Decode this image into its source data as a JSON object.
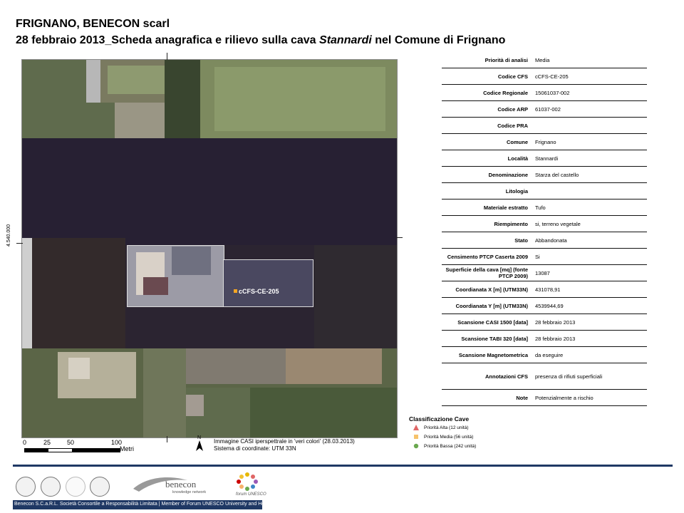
{
  "header": {
    "line1": "FRIGNANO, BENECON scarl",
    "line2_prefix": "28 febbraio 2013_Scheda anagrafica e rilievo sulla cava ",
    "line2_italic": "Stannardi",
    "line2_suffix": " nel Comune di Frignano"
  },
  "map": {
    "coord_label": "4.540.000",
    "site_label": "cCFS-CE-205",
    "scale": {
      "ticks": [
        "0",
        "25",
        "50",
        "100"
      ],
      "unit": "Metri"
    },
    "north_label": "N",
    "caption_line1": "Immagine CASI iperspettrale in 'veri colori' (28.03.2013)",
    "caption_line2": "Sistema di coordinate: UTM 33N"
  },
  "table": [
    {
      "label": "Priorità di analisi",
      "value": "Media"
    },
    {
      "label": "Codice CFS",
      "value": "cCFS-CE-205"
    },
    {
      "label": "Codice Regionale",
      "value": "15061037-002"
    },
    {
      "label": "Codice ARP",
      "value": "61037-002"
    },
    {
      "label": "Codice PRA",
      "value": ""
    },
    {
      "label": "Comune",
      "value": "Frignano"
    },
    {
      "label": "Località",
      "value": "Stannardi"
    },
    {
      "label": "Denominazione",
      "value": "Starza del castello"
    },
    {
      "label": "Litologia",
      "value": ""
    },
    {
      "label": "Materiale estratto",
      "value": "Tufo"
    },
    {
      "label": "Riempimento",
      "value": "si, terreno vegetale"
    },
    {
      "label": "Stato",
      "value": "Abbandonata"
    },
    {
      "label": "Censimento PTCP Caserta 2009",
      "value": "Si"
    },
    {
      "label": "Superficie della cava [mq] (fonte PTCP 2009)",
      "value": "13087"
    },
    {
      "label": "Coordianata X [m] (UTM33N)",
      "value": "431078,91"
    },
    {
      "label": "Coordianata Y [m] (UTM33N)",
      "value": "4539944,69"
    },
    {
      "label": "Scansione CASI 1500 [data]",
      "value": "28 febbraio 2013"
    },
    {
      "label": "Scansione TABI 320 [data]",
      "value": "28 febbraio 2013"
    },
    {
      "label": "Scansione Magnetometrica",
      "value": "da eseguire"
    },
    {
      "label": "Annotazioni CFS",
      "value": "presenza di rifiuti superficiali"
    },
    {
      "label": "Note",
      "value": "Potenzialmente a rischio"
    }
  ],
  "legend": {
    "title": "Classificazione Cave",
    "items": [
      {
        "label": "Priorità Alta (12 unità)",
        "symbol": "triangle",
        "color": "#e06666"
      },
      {
        "label": "Priorità Media (56 unità)",
        "symbol": "square",
        "color": "#f6c26b"
      },
      {
        "label": "Priorità Bassa (242 unità)",
        "symbol": "circle",
        "color": "#6aa84f"
      }
    ]
  },
  "footer": {
    "bar_text": "Benecon S.C.a.R.L. Società Consortile a Responsabilità Limitata | Member of Forum UNESCO University and Heritage",
    "benecon_logo_text": "benecon",
    "benecon_logo_sub": "knowledge network",
    "forum_logo_text": "forum UNESCO",
    "accent_color": "#1f3864"
  }
}
